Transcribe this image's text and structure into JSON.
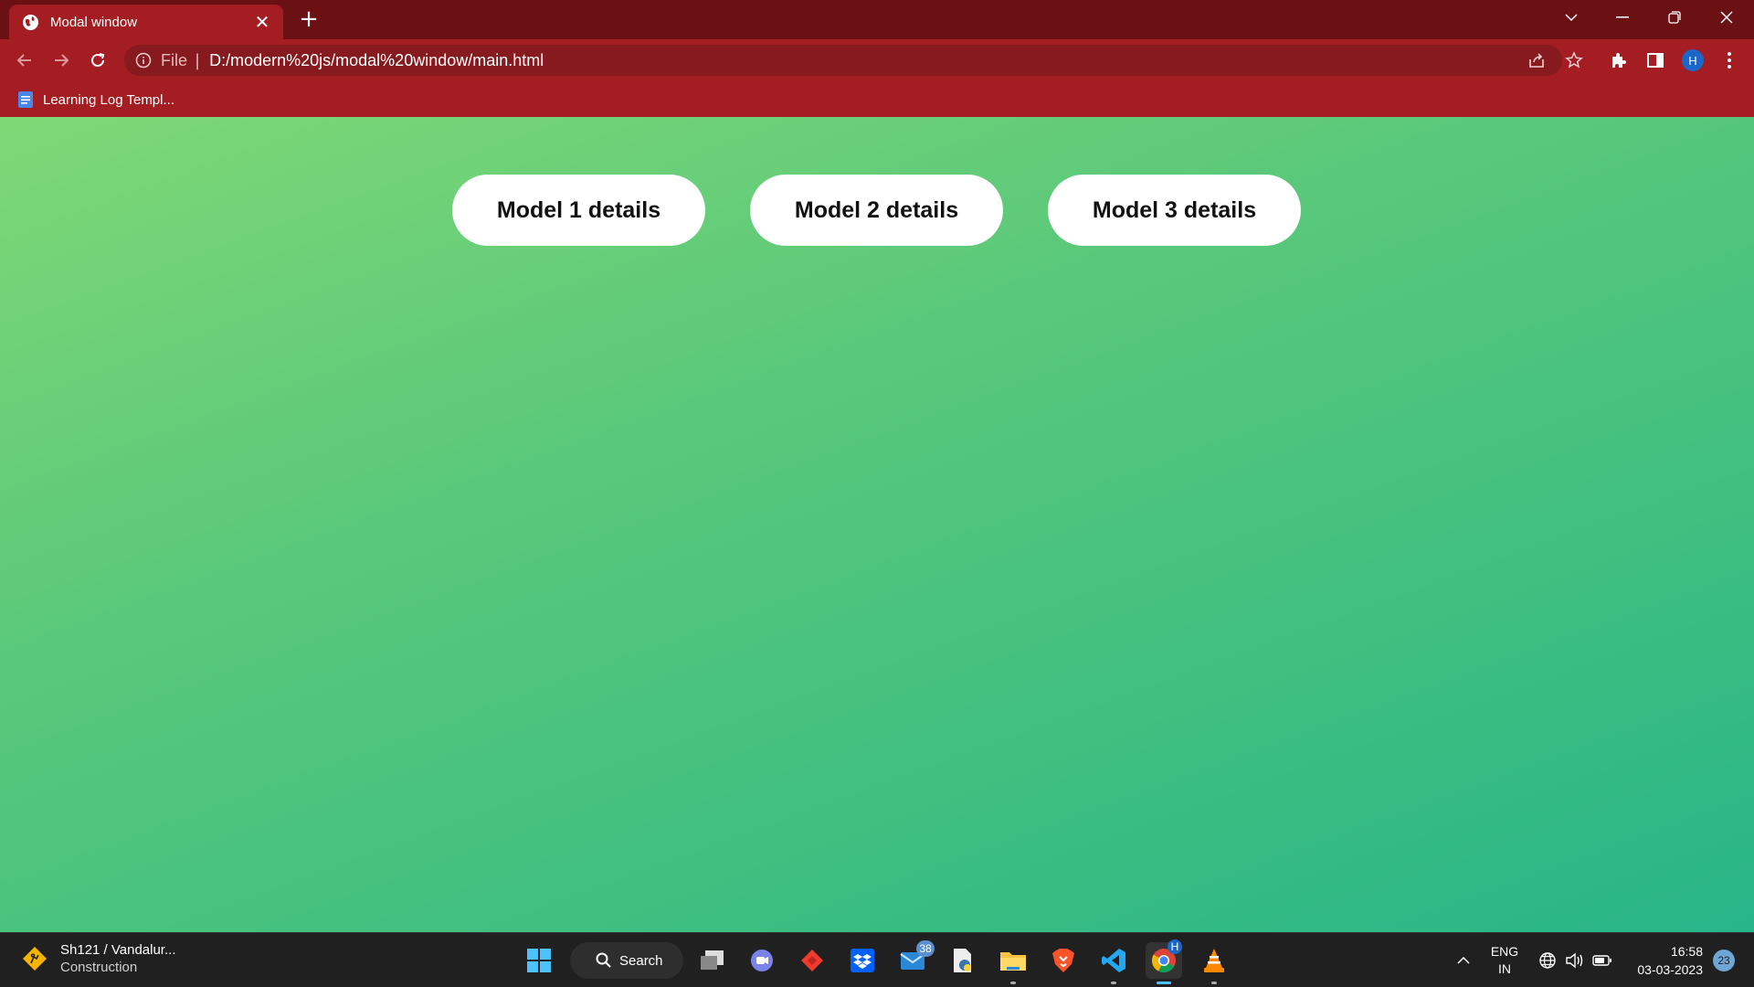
{
  "browser": {
    "tab": {
      "title": "Modal window",
      "favicon": "globe-icon",
      "close_glyph": "✕"
    },
    "new_tab_glyph": "+",
    "window_controls": [
      "tab-search-icon",
      "minimize-icon",
      "restore-icon",
      "close-window-icon"
    ],
    "toolbar": {
      "scheme": "File",
      "separator": "|",
      "url": "D:/modern%20js/modal%20window/main.html",
      "profile_initial": "H"
    },
    "bookmarks": [
      {
        "label": "Learning Log Templ...",
        "icon": "google-docs-icon"
      }
    ]
  },
  "page": {
    "background_colors": [
      "#7fd876",
      "#28b588"
    ],
    "buttons": [
      {
        "label": "Model 1 details"
      },
      {
        "label": "Model 2 details"
      },
      {
        "label": "Model 3 details"
      }
    ]
  },
  "taskbar": {
    "weather": {
      "title": "Sh121 / Vandalur...",
      "subtitle": "Construction",
      "icon": "road-warning-icon"
    },
    "search_label": "Search",
    "mail_badge": "38",
    "chrome_profile_badge": "H",
    "language": {
      "line1": "ENG",
      "line2": "IN"
    },
    "clock": {
      "time": "16:58",
      "date": "03-03-2023"
    },
    "notification_count": "23"
  }
}
